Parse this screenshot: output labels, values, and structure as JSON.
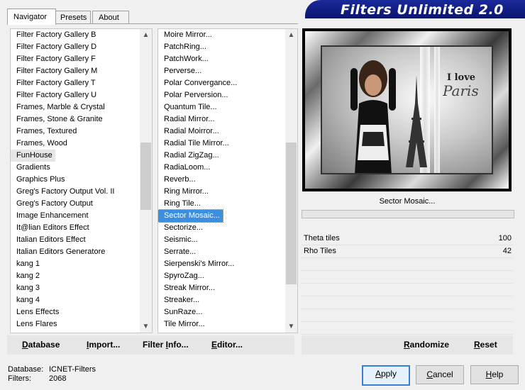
{
  "tabs": [
    "Navigator",
    "Presets",
    "About"
  ],
  "banner_title": "Filters Unlimited 2.0",
  "categories": [
    "Filter Factory Gallery B",
    "Filter Factory Gallery D",
    "Filter Factory Gallery F",
    "Filter Factory Gallery M",
    "Filter Factory Gallery T",
    "Filter Factory Gallery U",
    "Frames, Marble & Crystal",
    "Frames, Stone & Granite",
    "Frames, Textured",
    "Frames, Wood",
    "FunHouse",
    "Gradients",
    "Graphics Plus",
    "Greg's Factory Output Vol. II",
    "Greg's Factory Output",
    "Image Enhancement",
    "It@lian Editors Effect",
    "Italian Editors Effect",
    "Italian Editors Generatore",
    "kang 1",
    "kang 2",
    "kang 3",
    "kang 4",
    "Lens Effects",
    "Lens Flares"
  ],
  "filters": [
    "Moire Mirror...",
    "PatchRing...",
    "PatchWork...",
    "Perverse...",
    "Polar Convergance...",
    "Polar Perversion...",
    "Quantum Tile...",
    "Radial Mirror...",
    "Radial Moirror...",
    "Radial Tile Mirror...",
    "Radial ZigZag...",
    "RadiaLoom...",
    "Reverb...",
    "Ring Mirror...",
    "Ring Tile...",
    "Sector Mosaic...",
    "Sectorize...",
    "Seismic...",
    "Serrate...",
    "Sierpenski's Mirror...",
    "SpyroZag...",
    "Streak Mirror...",
    "Streaker...",
    "SunRaze...",
    "Tile Mirror..."
  ],
  "selected_category": "FunHouse",
  "selected_filter": "Sector Mosaic...",
  "preview": {
    "logo_line1": "I love",
    "logo_line2": "Paris"
  },
  "filter_name": "Sector Mosaic...",
  "params": [
    {
      "name": "Theta tiles",
      "value": "100"
    },
    {
      "name": "Rho Tiles",
      "value": "42"
    }
  ],
  "left_actions": {
    "database": {
      "u": "D",
      "rest": "atabase"
    },
    "import": {
      "u": "I",
      "rest": "mport..."
    },
    "filter_info": {
      "pre": "Filter ",
      "u": "I",
      "rest": "nfo..."
    },
    "editor": {
      "u": "E",
      "rest": "ditor..."
    }
  },
  "right_actions": {
    "randomize": {
      "u": "R",
      "rest": "andomize"
    },
    "reset": {
      "u": "R",
      "rest": "eset"
    }
  },
  "status": {
    "database_label": "Database:",
    "database_value": "ICNET-Filters",
    "filters_label": "Filters:",
    "filters_value": "2068"
  },
  "buttons": {
    "apply": {
      "u": "A",
      "rest": "pply"
    },
    "cancel": {
      "u": "C",
      "rest": "ancel"
    },
    "help": {
      "u": "H",
      "rest": "elp"
    }
  },
  "scroll_arrows": {
    "up": "▲",
    "down": "▼"
  }
}
